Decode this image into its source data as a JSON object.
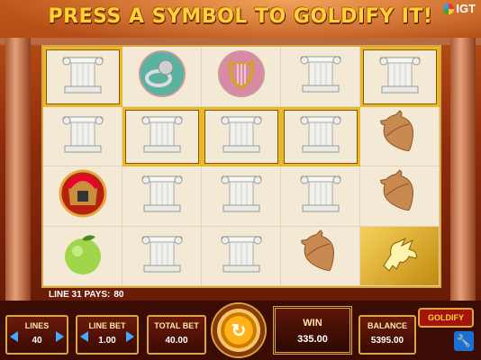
{
  "header": {
    "banner": "PRESS A SYMBOL TO GOLDIFY IT!",
    "logo_text": "IGT"
  },
  "reels": {
    "grid": [
      [
        "pillar",
        "ring",
        "lyre",
        "pillar",
        "pillar"
      ],
      [
        "pillar",
        "pillar",
        "pillar",
        "pillar",
        "amphora"
      ],
      [
        "helmet",
        "pillar",
        "pillar",
        "pillar",
        "amphora"
      ],
      [
        "apple",
        "pillar",
        "pillar",
        "amphora",
        "pegasus"
      ]
    ],
    "highlighted": [
      "0-0",
      "0-4",
      "1-1",
      "1-2",
      "1-3"
    ],
    "gold": [
      "3-4"
    ]
  },
  "line_pays": {
    "label": "LINE 31 PAYS:",
    "value": "80"
  },
  "controls": {
    "lines": {
      "label": "LINES",
      "value": "40"
    },
    "line_bet": {
      "label": "LINE BET",
      "value": "1.00"
    },
    "total_bet": {
      "label": "TOTAL BET",
      "value": "40.00"
    },
    "win": {
      "label": "WIN",
      "value": "335.00"
    },
    "balance": {
      "label": "BALANCE",
      "value": "5395.00"
    },
    "goldify_label": "GOLDIFY",
    "spin_icon": "spin-arrow-icon",
    "settings_icon": "wrench-icon"
  }
}
